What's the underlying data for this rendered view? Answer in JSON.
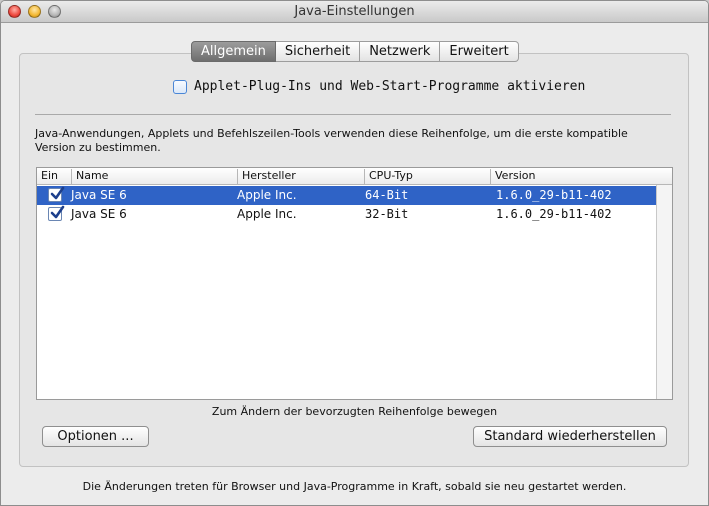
{
  "window": {
    "title": "Java-Einstellungen"
  },
  "tabs": [
    {
      "label": "Allgemein",
      "active": true
    },
    {
      "label": "Sicherheit",
      "active": false
    },
    {
      "label": "Netzwerk",
      "active": false
    },
    {
      "label": "Erweitert",
      "active": false
    }
  ],
  "applet": {
    "label": "Applet-Plug-Ins und Web-Start-Programme aktivieren",
    "checked": false
  },
  "description": "Java-Anwendungen, Applets und Befehlszeilen-Tools verwenden diese Reihenfolge, um die erste kompatible Version zu bestimmen.",
  "table": {
    "headers": [
      "Ein",
      "Name",
      "Hersteller",
      "CPU-Typ",
      "Version"
    ],
    "rows": [
      {
        "enabled": true,
        "name": "Java SE 6",
        "vendor": "Apple Inc.",
        "cpu": "64-Bit",
        "version": "1.6.0_29-b11-402",
        "selected": true
      },
      {
        "enabled": true,
        "name": "Java SE 6",
        "vendor": "Apple Inc.",
        "cpu": "32-Bit",
        "version": "1.6.0_29-b11-402",
        "selected": false
      }
    ]
  },
  "hint": "Zum Ändern der bevorzugten Reihenfolge bewegen",
  "buttons": {
    "options": "Optionen ...",
    "restore": "Standard wiederherstellen"
  },
  "footer": "Die Änderungen treten für Browser und Java-Programme in Kraft, sobald sie neu gestartet werden.",
  "colors": {
    "selection": "#2f63c6",
    "active_tab": "#7a7a7a",
    "checkbox_accent": "#4a86d6"
  },
  "icons": {
    "check": "checkmark-icon"
  }
}
